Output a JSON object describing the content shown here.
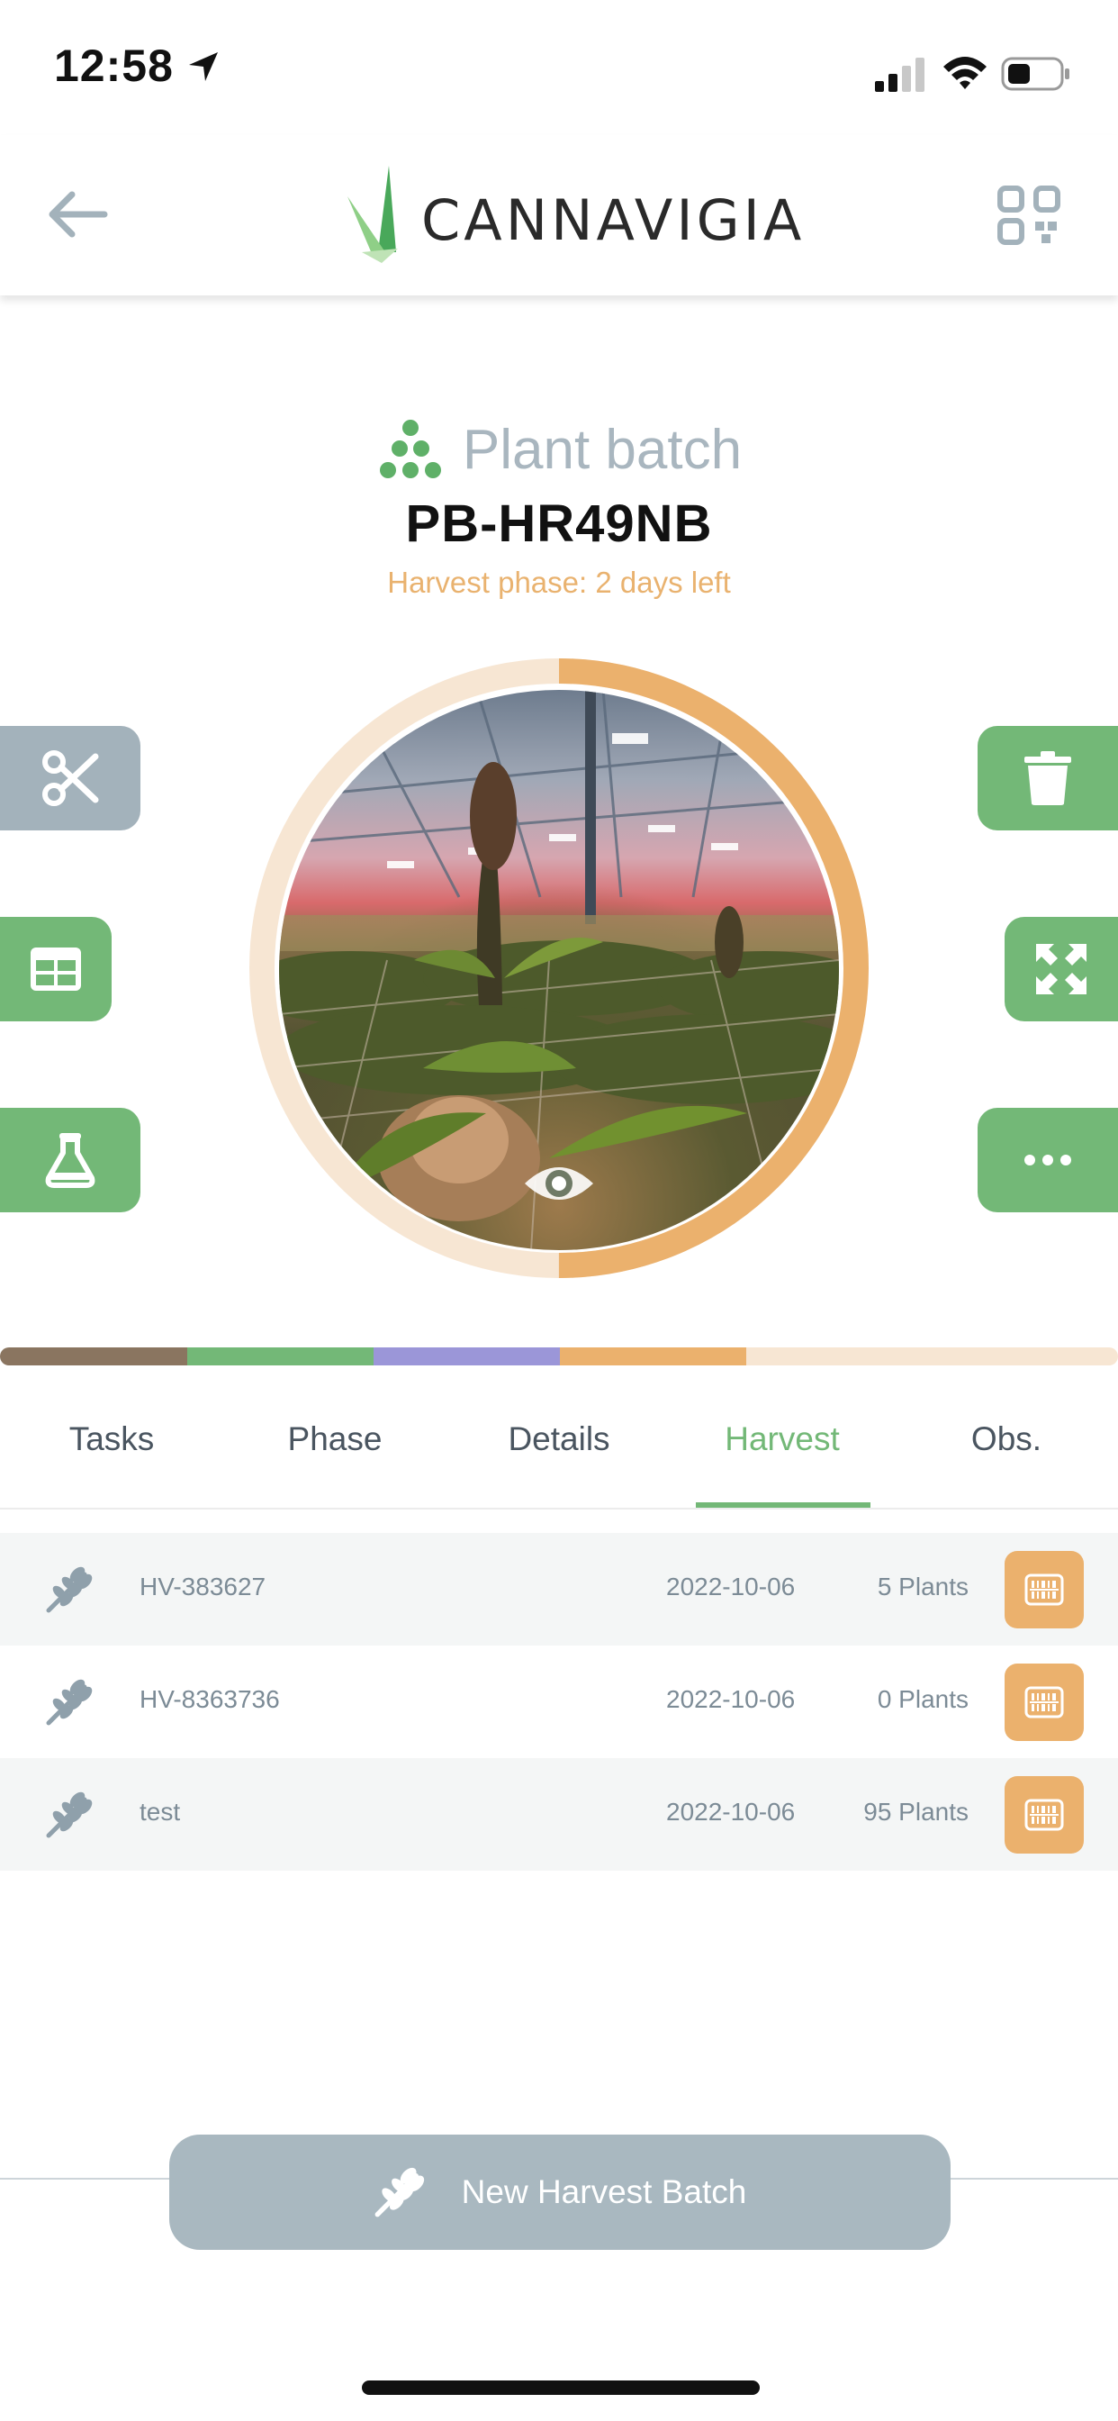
{
  "status_bar": {
    "time": "12:58"
  },
  "header": {
    "logo_text": "CANNAVIGIA"
  },
  "batch": {
    "type_label": "Plant batch",
    "id": "PB-HR49NB",
    "phase_info": "Harvest phase: 2 days left",
    "phase_progress": 0.5
  },
  "phase_colors": [
    "#8a7560",
    "#73b877",
    "#9b96d8",
    "#ebb16d",
    "#f7e6d3"
  ],
  "tabs": [
    {
      "label": "Tasks"
    },
    {
      "label": "Phase"
    },
    {
      "label": "Details"
    },
    {
      "label": "Harvest",
      "active": true
    },
    {
      "label": "Obs."
    }
  ],
  "harvests": [
    {
      "id": "HV-383627",
      "date": "2022-10-06",
      "count": "5 Plants"
    },
    {
      "id": "HV-8363736",
      "date": "2022-10-06",
      "count": "0 Plants"
    },
    {
      "id": "test",
      "date": "2022-10-06",
      "count": "95 Plants"
    }
  ],
  "new_batch_button": {
    "label": "New Harvest Batch"
  },
  "icons": {
    "left_actions": [
      "scissors-icon",
      "table-icon",
      "flask-icon"
    ],
    "right_actions": [
      "trash-icon",
      "expand-icon",
      "more-icon"
    ],
    "row": "wheat-icon",
    "row_action": "barcode-icon"
  },
  "colors": {
    "accent_green": "#73b877",
    "accent_orange": "#ebb16d",
    "muted_gray": "#a9b8c0"
  }
}
